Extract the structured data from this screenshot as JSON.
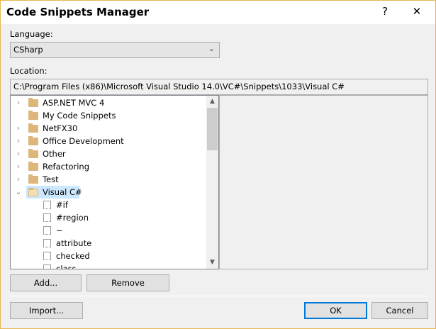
{
  "window": {
    "title": "Code Snippets Manager",
    "help_label": "?",
    "close_label": "✕"
  },
  "language": {
    "label": "Language:",
    "value": "CSharp"
  },
  "location": {
    "label": "Location:",
    "value": "C:\\Program Files (x86)\\Microsoft Visual Studio 14.0\\VC#\\Snippets\\1033\\Visual C#"
  },
  "tree": {
    "folders": [
      {
        "name": "ASP.NET MVC 4",
        "expandable": true
      },
      {
        "name": "My Code Snippets",
        "expandable": false
      },
      {
        "name": "NetFX30",
        "expandable": true
      },
      {
        "name": "Office Development",
        "expandable": true
      },
      {
        "name": "Other",
        "expandable": true
      },
      {
        "name": "Refactoring",
        "expandable": true
      },
      {
        "name": "Test",
        "expandable": true
      },
      {
        "name": "Visual C#",
        "expandable": true,
        "expanded": true,
        "selected": true
      }
    ],
    "snippets": [
      "#if",
      "#region",
      "~",
      "attribute",
      "checked",
      "class"
    ]
  },
  "buttons": {
    "add": "Add...",
    "remove": "Remove",
    "import": "Import...",
    "ok": "OK",
    "cancel": "Cancel"
  }
}
